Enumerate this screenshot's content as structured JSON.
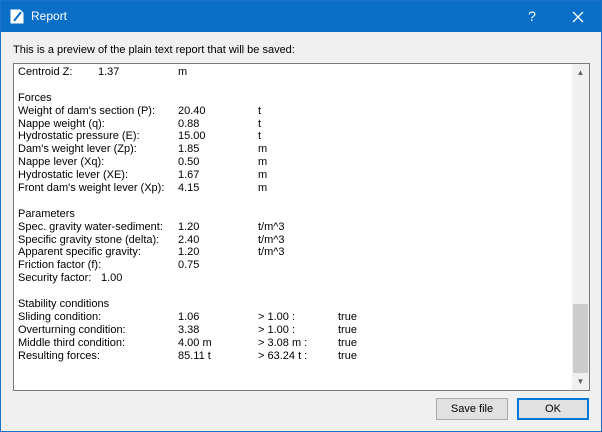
{
  "window": {
    "title": "Report",
    "help_label": "?",
    "close_label": "✕",
    "icon": "document-icon"
  },
  "intro_text": "This is a preview of the plain text report that will be saved:",
  "report": {
    "centroid": {
      "label": "Centroid Z:",
      "value": "1.37",
      "unit": "m"
    },
    "forces": {
      "heading": "Forces",
      "rows": [
        {
          "label": "Weight of dam's section (P):",
          "value": "20.40",
          "unit": "t"
        },
        {
          "label": "Nappe weight (q):",
          "value": "0.88",
          "unit": "t"
        },
        {
          "label": "Hydrostatic pressure (E):",
          "value": "15.00",
          "unit": "t"
        },
        {
          "label": "Dam's weight lever (Zp):",
          "value": "1.85",
          "unit": "m"
        },
        {
          "label": "Nappe lever (Xq):",
          "value": "0.50",
          "unit": "m"
        },
        {
          "label": "Hydrostatic lever (XE):",
          "value": "1.67",
          "unit": "m"
        },
        {
          "label": "Front dam's weight lever (Xp):",
          "value": "4.15",
          "unit": "m"
        }
      ]
    },
    "parameters": {
      "heading": "Parameters",
      "rows": [
        {
          "label": "Spec. gravity water-sediment:",
          "value": "1.20",
          "unit": "t/m^3"
        },
        {
          "label": "Specific gravity stone (delta):",
          "value": "2.40",
          "unit": "t/m^3"
        },
        {
          "label": "Apparent specific gravity:",
          "value": "1.20",
          "unit": "t/m^3"
        },
        {
          "label": "Friction factor (f):",
          "value": "0.75",
          "unit": ""
        }
      ],
      "security": {
        "label": "Security factor:",
        "value": "1.00"
      }
    },
    "stability": {
      "heading": "Stability conditions",
      "rows": [
        {
          "label": "Sliding condition:",
          "value": "1.06",
          "threshold": "> 1.00 :",
          "result": "true"
        },
        {
          "label": "Overturning condition:",
          "value": "3.38",
          "threshold": "> 1.00 :",
          "result": "true"
        },
        {
          "label": "Middle third condition:",
          "value": "4.00 m",
          "threshold": "> 3.08 m :",
          "result": "true"
        },
        {
          "label": "Resulting forces:",
          "value": "85.11 t",
          "threshold": "> 63.24 t :",
          "result": "true"
        }
      ]
    }
  },
  "scrollbar": {
    "up_icon": "scroll-up-arrow-icon",
    "down_icon": "scroll-down-arrow-icon"
  },
  "buttons": {
    "save_label": "Save file",
    "ok_label": "OK"
  }
}
